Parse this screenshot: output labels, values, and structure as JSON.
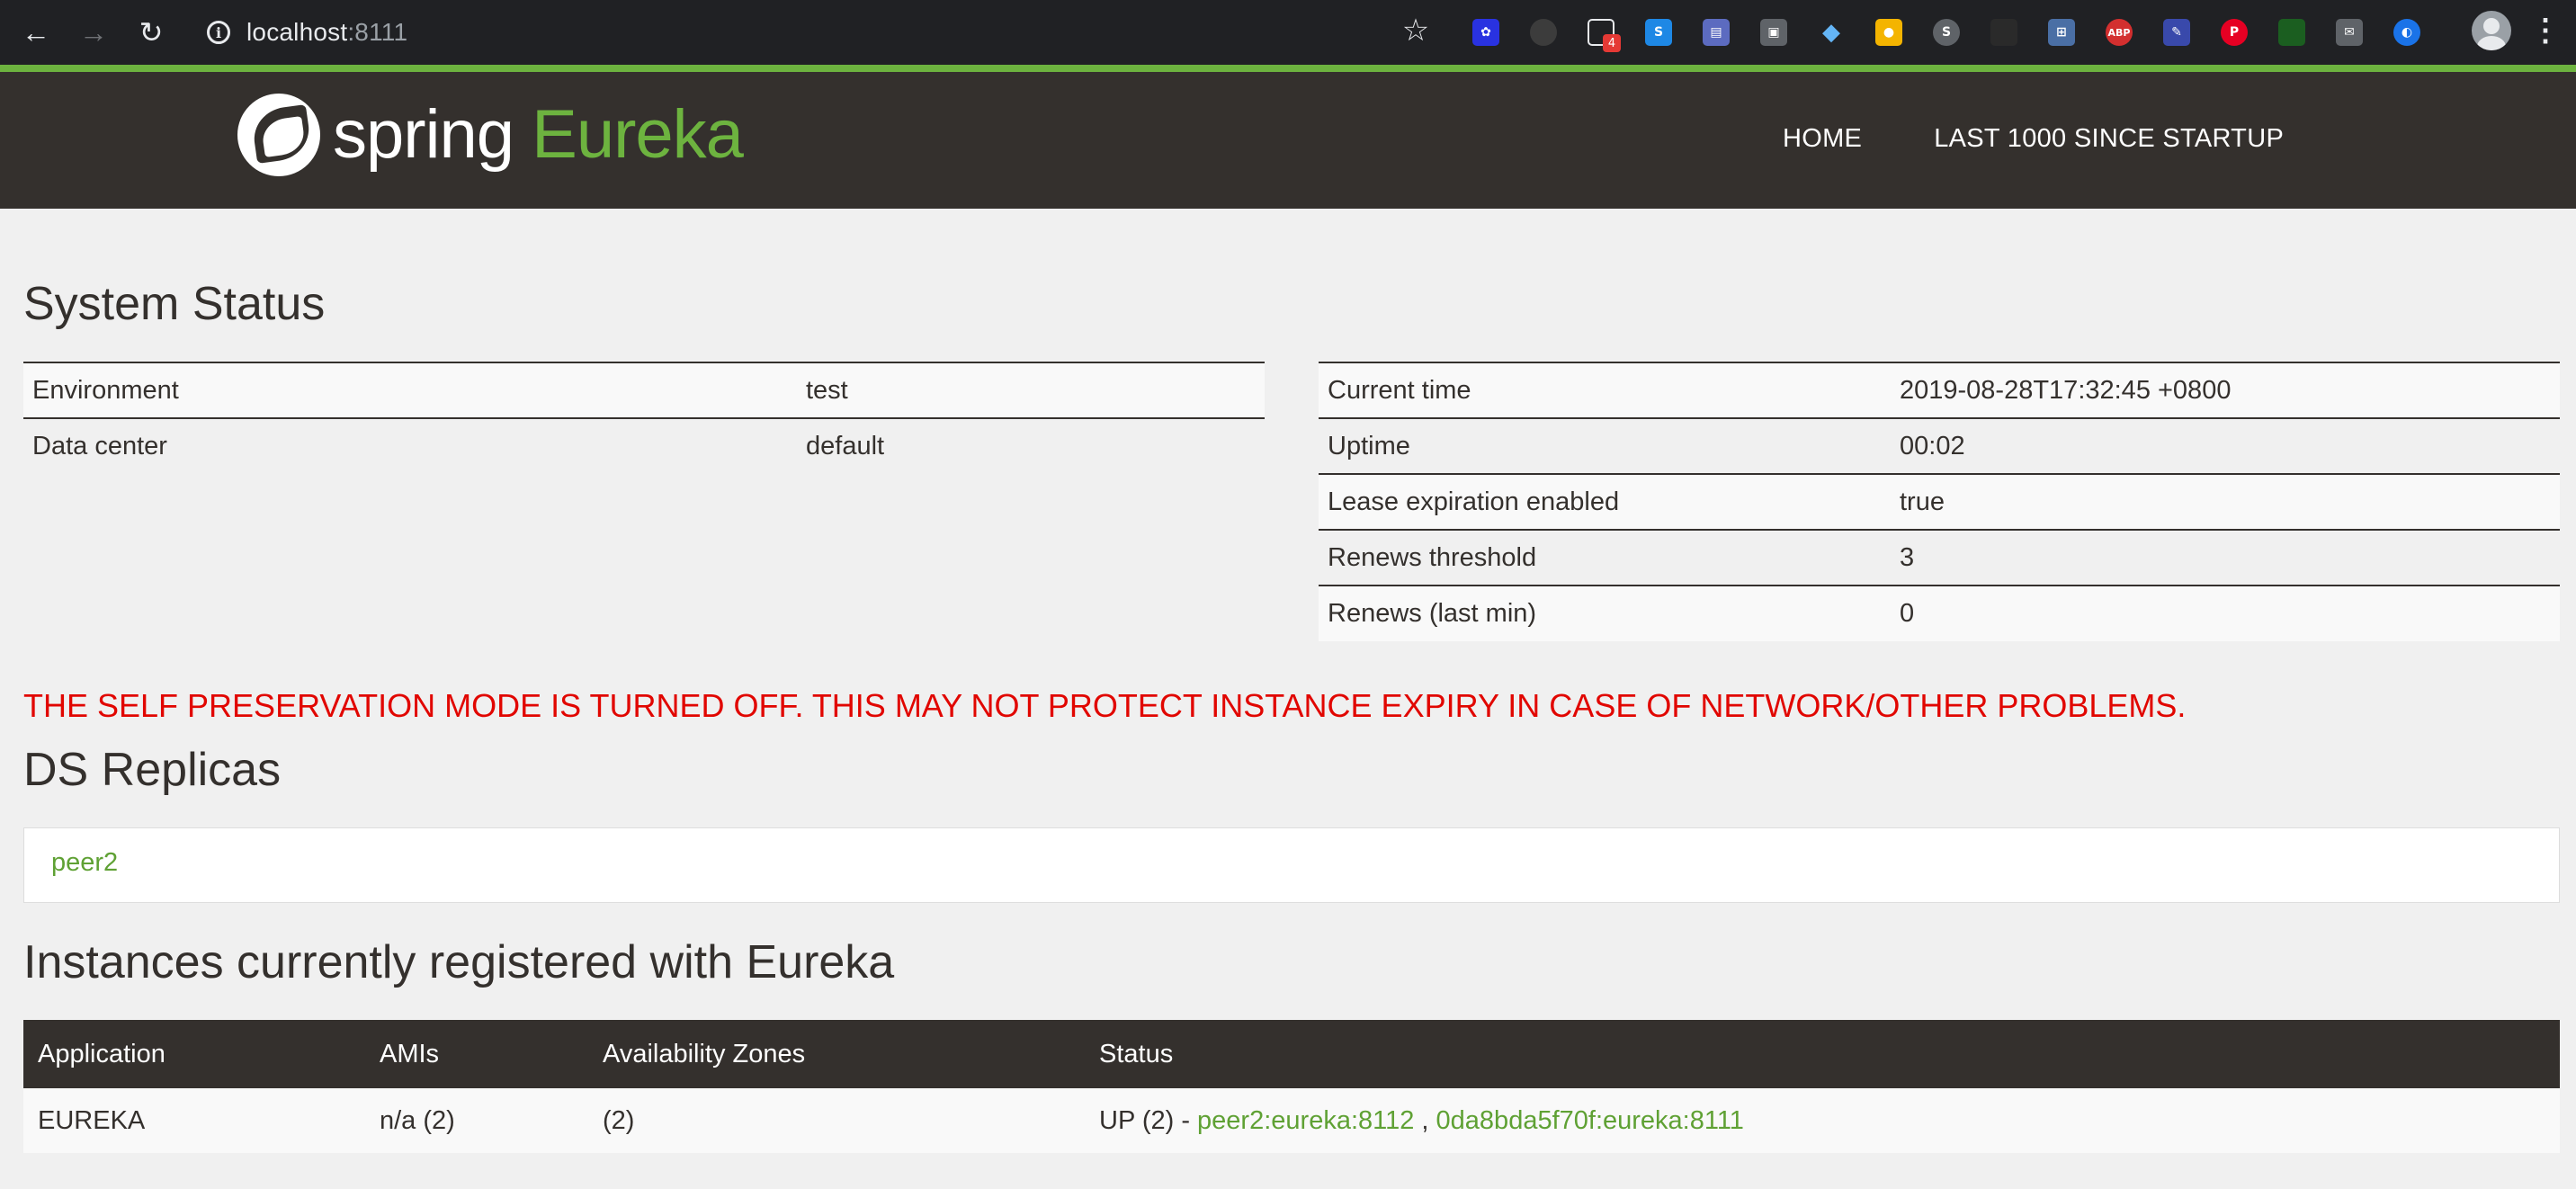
{
  "browser": {
    "url_host": "localhost",
    "url_port": ":8111",
    "extension_badge": "4",
    "abp_label": "ABP"
  },
  "navbar": {
    "logo_word1": "spring",
    "logo_word2": "Eureka",
    "links": [
      "HOME",
      "LAST 1000 SINCE STARTUP"
    ]
  },
  "system_status": {
    "title": "System Status",
    "left": [
      {
        "label": "Environment",
        "value": "test"
      },
      {
        "label": "Data center",
        "value": "default"
      }
    ],
    "right": [
      {
        "label": "Current time",
        "value": "2019-08-28T17:32:45 +0800"
      },
      {
        "label": "Uptime",
        "value": "00:02"
      },
      {
        "label": "Lease expiration enabled",
        "value": "true"
      },
      {
        "label": "Renews threshold",
        "value": "3"
      },
      {
        "label": "Renews (last min)",
        "value": "0"
      }
    ]
  },
  "warning": "THE SELF PRESERVATION MODE IS TURNED OFF. THIS MAY NOT PROTECT INSTANCE EXPIRY IN CASE OF NETWORK/OTHER PROBLEMS.",
  "replicas": {
    "title": "DS Replicas",
    "items": [
      "peer2"
    ]
  },
  "instances": {
    "title": "Instances currently registered with Eureka",
    "headers": [
      "Application",
      "AMIs",
      "Availability Zones",
      "Status"
    ],
    "rows": [
      {
        "application": "EUREKA",
        "amis": "n/a (2)",
        "zones": "(2)",
        "status_prefix": "UP (2) - ",
        "links": [
          "peer2:eureka:8112",
          "0da8bda5f70f:eureka:8111"
        ],
        "separator": " , "
      }
    ]
  }
}
